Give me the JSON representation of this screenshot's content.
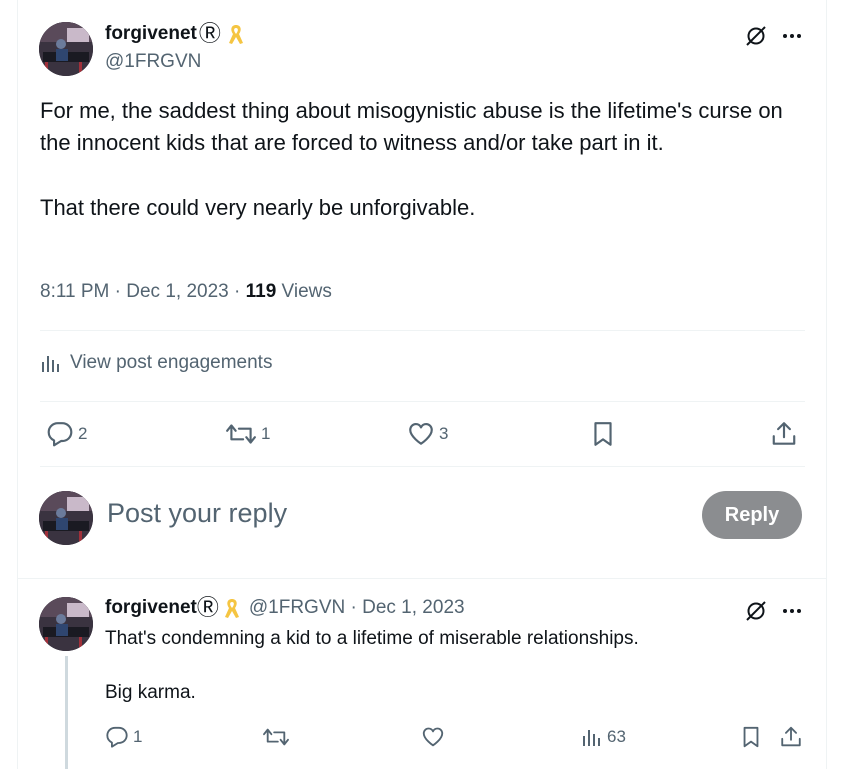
{
  "tweet": {
    "display_name": "forgivenet",
    "name_symbol": "Ⓡ",
    "handle": "@1FRGVN",
    "text_para1": "For me, the saddest thing about misogynistic abuse is the lifetime's curse on the innocent kids that are forced to witness and/or take part in it.",
    "text_para2": "That there could very nearly be unforgivable.",
    "time": "8:11 PM",
    "sep": "·",
    "date": "Dec 1, 2023",
    "views_count": "119",
    "views_label": "Views",
    "engagements_label": "View post engagements",
    "reply_count": "2",
    "repost_count": "1",
    "like_count": "3"
  },
  "composer": {
    "placeholder": "Post your reply",
    "reply_button": "Reply"
  },
  "reply": {
    "display_name": "forgivenet",
    "name_symbol": "Ⓡ",
    "handle_date": "@1FRGVN · Dec 1, 2023",
    "line1": "That's condemning a kid to a lifetime of miserable relationships.",
    "line2": "Big karma.",
    "reply_count": "1",
    "views_count": "63"
  },
  "colors": {
    "ribbon": "#f5c542",
    "muted": "#536471",
    "reply_button_bg": "#8b8d90"
  },
  "icons": [
    "grok-icon",
    "more-icon",
    "analytics-icon",
    "reply-icon",
    "repost-icon",
    "like-icon",
    "bookmark-icon",
    "share-icon"
  ]
}
